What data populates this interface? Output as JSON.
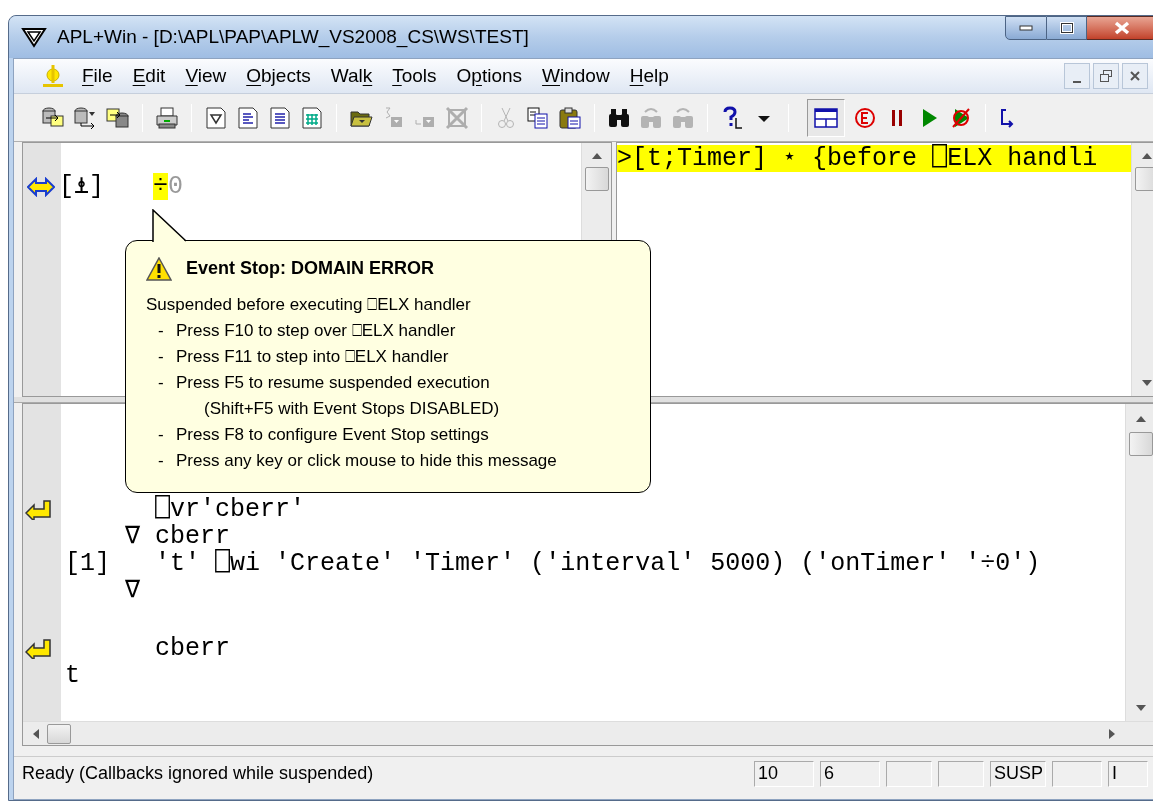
{
  "window": {
    "title": "APL+Win - [D:\\APL\\PAP\\APLW_VS2008_CS\\WS\\TEST]"
  },
  "menu": [
    {
      "key": "F",
      "post": "ile"
    },
    {
      "key": "E",
      "post": "dit"
    },
    {
      "key": "V",
      "post": "iew"
    },
    {
      "key": "O",
      "post": "bjects"
    },
    {
      "pre": "Wal",
      "key": "k"
    },
    {
      "key": "T",
      "post": "ools"
    },
    {
      "pre": "O",
      "key": "p",
      "post": "tions"
    },
    {
      "key": "W",
      "post": "indow"
    },
    {
      "key": "H",
      "post": "elp"
    }
  ],
  "toolbar": [
    {
      "kind": "ws-load"
    },
    {
      "kind": "ws-copy"
    },
    {
      "kind": "ws-save"
    },
    {
      "kind": "separator"
    },
    {
      "kind": "print"
    },
    {
      "kind": "separator"
    },
    {
      "kind": "new-function"
    },
    {
      "kind": "new-doc"
    },
    {
      "kind": "new-text"
    },
    {
      "kind": "new-grid"
    },
    {
      "kind": "separator"
    },
    {
      "kind": "open"
    },
    {
      "kind": "step-in",
      "disabled": true
    },
    {
      "kind": "step-out",
      "disabled": true
    },
    {
      "kind": "delete",
      "disabled": true
    },
    {
      "kind": "separator"
    },
    {
      "kind": "cut",
      "disabled": true
    },
    {
      "kind": "copy"
    },
    {
      "kind": "paste"
    },
    {
      "kind": "separator"
    },
    {
      "kind": "find"
    },
    {
      "kind": "find-next",
      "disabled": true
    },
    {
      "kind": "find-prev",
      "disabled": true
    },
    {
      "kind": "separator"
    },
    {
      "kind": "help"
    },
    {
      "kind": "dropdown"
    },
    {
      "kind": "separator"
    },
    {
      "kind": "layout",
      "pressed": true
    },
    {
      "kind": "event"
    },
    {
      "kind": "pause"
    },
    {
      "kind": "run"
    },
    {
      "kind": "stop-run"
    },
    {
      "kind": "separator"
    },
    {
      "kind": "partial"
    }
  ],
  "stack_pane": {
    "lines": [
      {
        "kind": "current",
        "label": "[⍎]",
        "highlight": "÷",
        "rest": "0"
      }
    ]
  },
  "trace_pane": {
    "lines": [
      {
        "text": ">[t;Timer] ⋆ {before ⎕ELX handli",
        "highlighted": true
      }
    ]
  },
  "tooltip": {
    "title": "Event Stop: DOMAIN ERROR",
    "intro": "Suspended before executing ⎕ELX handler",
    "items": [
      {
        "dash": "-",
        "text": "Press F10 to step over ⎕ELX handler"
      },
      {
        "dash": "-",
        "text": "Press F11 to step into ⎕ELX handler"
      },
      {
        "dash": "-",
        "text": "Press F5 to resume suspended execution"
      },
      {
        "text": "(Shift+F5 with Event Stops DISABLED)"
      },
      {
        "dash": "-",
        "text": "Press F8 to configure Event Stop settings"
      },
      {
        "dash": "-",
        "text": "Press any key or click mouse to hide this message"
      }
    ]
  },
  "session": {
    "lines": [
      {
        "kind": "input",
        "text": "      ⎕vr'cberr'"
      },
      {
        "kind": "output",
        "text": "    ∇ cberr"
      },
      {
        "kind": "output",
        "text": "[1]   't' ⎕wi 'Create' 'Timer' ('interval' 5000) ('onTimer' '÷0')"
      },
      {
        "kind": "output",
        "text": "    ∇"
      },
      {
        "kind": "input",
        "text": "      cberr",
        "gap_before": true
      },
      {
        "kind": "output",
        "text": "t"
      }
    ]
  },
  "status_bar": {
    "message": "Ready (Callbacks ignored while suspended)",
    "panels": [
      {
        "kind": "text",
        "text": "10"
      },
      {
        "kind": "text",
        "text": "6"
      },
      {
        "kind": "blank"
      },
      {
        "kind": "blank"
      },
      {
        "kind": "text",
        "text": "SUSP"
      },
      {
        "kind": "blank"
      },
      {
        "kind": "text",
        "text": "I"
      }
    ]
  }
}
